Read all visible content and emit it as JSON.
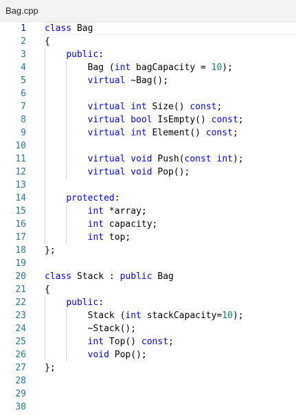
{
  "tab": {
    "title": "Bag.cpp"
  },
  "editor": {
    "active_line": 1,
    "line_numbers": [
      "1",
      "2",
      "3",
      "4",
      "5",
      "6",
      "7",
      "8",
      "9",
      "10",
      "11",
      "12",
      "13",
      "14",
      "15",
      "16",
      "17",
      "18",
      "19",
      "20",
      "21",
      "22",
      "23",
      "24",
      "25",
      "26",
      "27",
      "28",
      "29",
      "30"
    ],
    "lines": [
      [
        {
          "t": "class",
          "c": "kw"
        },
        {
          "t": " Bag"
        }
      ],
      [
        {
          "t": "{"
        }
      ],
      [
        {
          "t": "    "
        },
        {
          "t": "public",
          "c": "kw"
        },
        {
          "t": ":"
        }
      ],
      [
        {
          "t": "        Bag ("
        },
        {
          "t": "int",
          "c": "kw"
        },
        {
          "t": " bagCapacity = "
        },
        {
          "t": "10",
          "c": "num"
        },
        {
          "t": ");"
        }
      ],
      [
        {
          "t": "        "
        },
        {
          "t": "virtual",
          "c": "kw"
        },
        {
          "t": " ~Bag();"
        }
      ],
      [],
      [
        {
          "t": "        "
        },
        {
          "t": "virtual",
          "c": "kw"
        },
        {
          "t": " "
        },
        {
          "t": "int",
          "c": "kw"
        },
        {
          "t": " Size() "
        },
        {
          "t": "const",
          "c": "kw"
        },
        {
          "t": ";"
        }
      ],
      [
        {
          "t": "        "
        },
        {
          "t": "virtual",
          "c": "kw"
        },
        {
          "t": " "
        },
        {
          "t": "bool",
          "c": "kw"
        },
        {
          "t": " IsEmpty() "
        },
        {
          "t": "const",
          "c": "kw"
        },
        {
          "t": ";"
        }
      ],
      [
        {
          "t": "        "
        },
        {
          "t": "virtual",
          "c": "kw"
        },
        {
          "t": " "
        },
        {
          "t": "int",
          "c": "kw"
        },
        {
          "t": " Element() "
        },
        {
          "t": "const",
          "c": "kw"
        },
        {
          "t": ";"
        }
      ],
      [],
      [
        {
          "t": "        "
        },
        {
          "t": "virtual",
          "c": "kw"
        },
        {
          "t": " "
        },
        {
          "t": "void",
          "c": "kw"
        },
        {
          "t": " Push("
        },
        {
          "t": "const",
          "c": "kw"
        },
        {
          "t": " "
        },
        {
          "t": "int",
          "c": "kw"
        },
        {
          "t": ");"
        }
      ],
      [
        {
          "t": "        "
        },
        {
          "t": "virtual",
          "c": "kw"
        },
        {
          "t": " "
        },
        {
          "t": "void",
          "c": "kw"
        },
        {
          "t": " Pop();"
        }
      ],
      [],
      [
        {
          "t": "    "
        },
        {
          "t": "protected",
          "c": "kw"
        },
        {
          "t": ":"
        }
      ],
      [
        {
          "t": "        "
        },
        {
          "t": "int",
          "c": "kw"
        },
        {
          "t": " *array;"
        }
      ],
      [
        {
          "t": "        "
        },
        {
          "t": "int",
          "c": "kw"
        },
        {
          "t": " capacity;"
        }
      ],
      [
        {
          "t": "        "
        },
        {
          "t": "int",
          "c": "kw"
        },
        {
          "t": " top;"
        }
      ],
      [
        {
          "t": "};"
        }
      ],
      [],
      [
        {
          "t": "class",
          "c": "kw"
        },
        {
          "t": " Stack : "
        },
        {
          "t": "public",
          "c": "kw"
        },
        {
          "t": " Bag"
        }
      ],
      [
        {
          "t": "{"
        }
      ],
      [
        {
          "t": "    "
        },
        {
          "t": "public",
          "c": "kw"
        },
        {
          "t": ":"
        }
      ],
      [
        {
          "t": "        Stack ("
        },
        {
          "t": "int",
          "c": "kw"
        },
        {
          "t": " stackCapacity="
        },
        {
          "t": "10",
          "c": "num"
        },
        {
          "t": ");"
        }
      ],
      [
        {
          "t": "        ~Stack();"
        }
      ],
      [
        {
          "t": "        "
        },
        {
          "t": "int",
          "c": "kw"
        },
        {
          "t": " Top() "
        },
        {
          "t": "const",
          "c": "kw"
        },
        {
          "t": ";"
        }
      ],
      [
        {
          "t": "        "
        },
        {
          "t": "void",
          "c": "kw"
        },
        {
          "t": " Pop();"
        }
      ],
      [
        {
          "t": "};"
        }
      ],
      [],
      [],
      []
    ]
  }
}
